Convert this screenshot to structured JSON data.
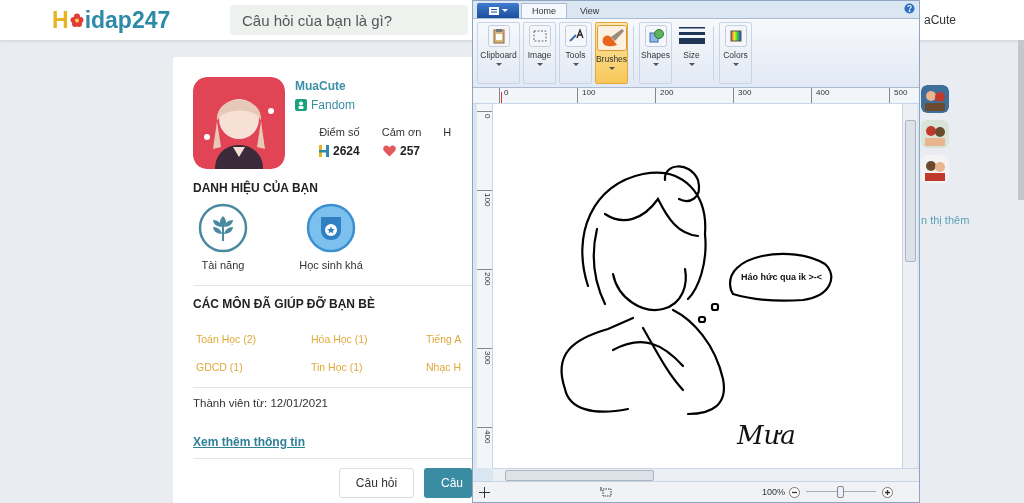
{
  "header": {
    "logo_letter": "H",
    "logo_rest": "idap247",
    "search": {
      "placeholder": "Câu hỏi của bạn là gì?"
    },
    "user_name": "aCute"
  },
  "profile": {
    "name": "MuaCute",
    "rank": "Fandom",
    "stats": [
      {
        "label": "Điểm số",
        "value": "2624",
        "kind": "points"
      },
      {
        "label": "Cảm ơn",
        "value": "257",
        "kind": "thanks"
      },
      {
        "label": "H",
        "kind": "label-only"
      }
    ],
    "titles_heading": "DANH HIỆU CỦA BẠN",
    "titles": [
      {
        "label": "Tài năng",
        "kind": "talent"
      },
      {
        "label": "Học sinh khá",
        "kind": "good-student"
      }
    ],
    "subjects_heading": "CÁC MÔN ĐÃ GIÚP ĐỠ BẠN BÈ",
    "subjects": [
      "Toán Học (2)",
      "Hóa Học (1)",
      "Tiếng A",
      "GDCD (1)",
      "Tin Học (1)",
      "Nhạc H"
    ],
    "member_since": "Thành viên từ: 12/01/2021",
    "more_link": "Xem thêm thông tin",
    "buttons": [
      {
        "label": "Câu hỏi",
        "kind": "secondary"
      },
      {
        "label": "Câu",
        "kind": "primary"
      }
    ]
  },
  "sidebar": {
    "more_link": "n thị thêm"
  },
  "paint": {
    "tabs": [
      {
        "label": "Home",
        "selected": true
      },
      {
        "label": "View",
        "selected": false
      }
    ],
    "groups": [
      {
        "label": "Clipboard",
        "kind": "clipboard",
        "selected": false
      },
      {
        "label": "Image",
        "selected": false
      },
      {
        "label": "Tools",
        "kind": "tools",
        "selected": false
      },
      {
        "label": "Brushes",
        "kind": "brushes",
        "selected": true
      },
      {
        "label": "Shapes",
        "kind": "shapes",
        "selected": false
      },
      {
        "label": "Size",
        "kind": "size",
        "selected": false
      },
      {
        "label": "Colors",
        "kind": "colors",
        "selected": false
      }
    ],
    "ruler_marks": [
      "0",
      "100",
      "200",
      "300",
      "400",
      "500"
    ],
    "vruler_marks": [
      "0",
      "100",
      "200",
      "300",
      "400"
    ],
    "bubble_text": "Háo hức qua ik >-<",
    "signature": "Mưa",
    "zoom": "100%",
    "zoom_slider": {
      "level": 0.5
    }
  }
}
